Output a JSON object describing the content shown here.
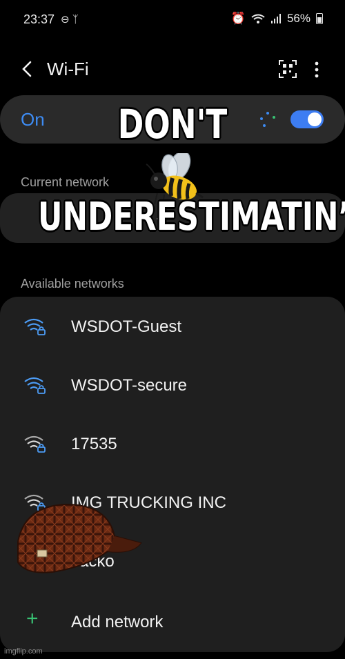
{
  "status_bar": {
    "time": "23:37",
    "left_icons": [
      "dnd-icon",
      "flashlight-icon"
    ],
    "right_icons": [
      "alarm-icon",
      "wifi-icon",
      "signal-icon"
    ],
    "battery": "56%"
  },
  "header": {
    "title": "Wi-Fi"
  },
  "wifi_toggle": {
    "label": "On",
    "enabled": true,
    "accent": "#3d8bf2"
  },
  "current_network": {
    "section_label": "Current network"
  },
  "available_networks": {
    "section_label": "Available networks",
    "items": [
      {
        "name": "WSDOT-Guest",
        "secured": true
      },
      {
        "name": "WSDOT-secure",
        "secured": true
      },
      {
        "name": "17535",
        "secured": true
      },
      {
        "name": "IMG TRUCKING INC",
        "secured": true
      },
      {
        "name": "Jacko",
        "secured": true
      }
    ],
    "add_label": "Add network"
  },
  "meme": {
    "top_text": "DON'T",
    "bottom_text": "UNDERESTIMATIN’"
  },
  "watermark": "imgflip.com"
}
